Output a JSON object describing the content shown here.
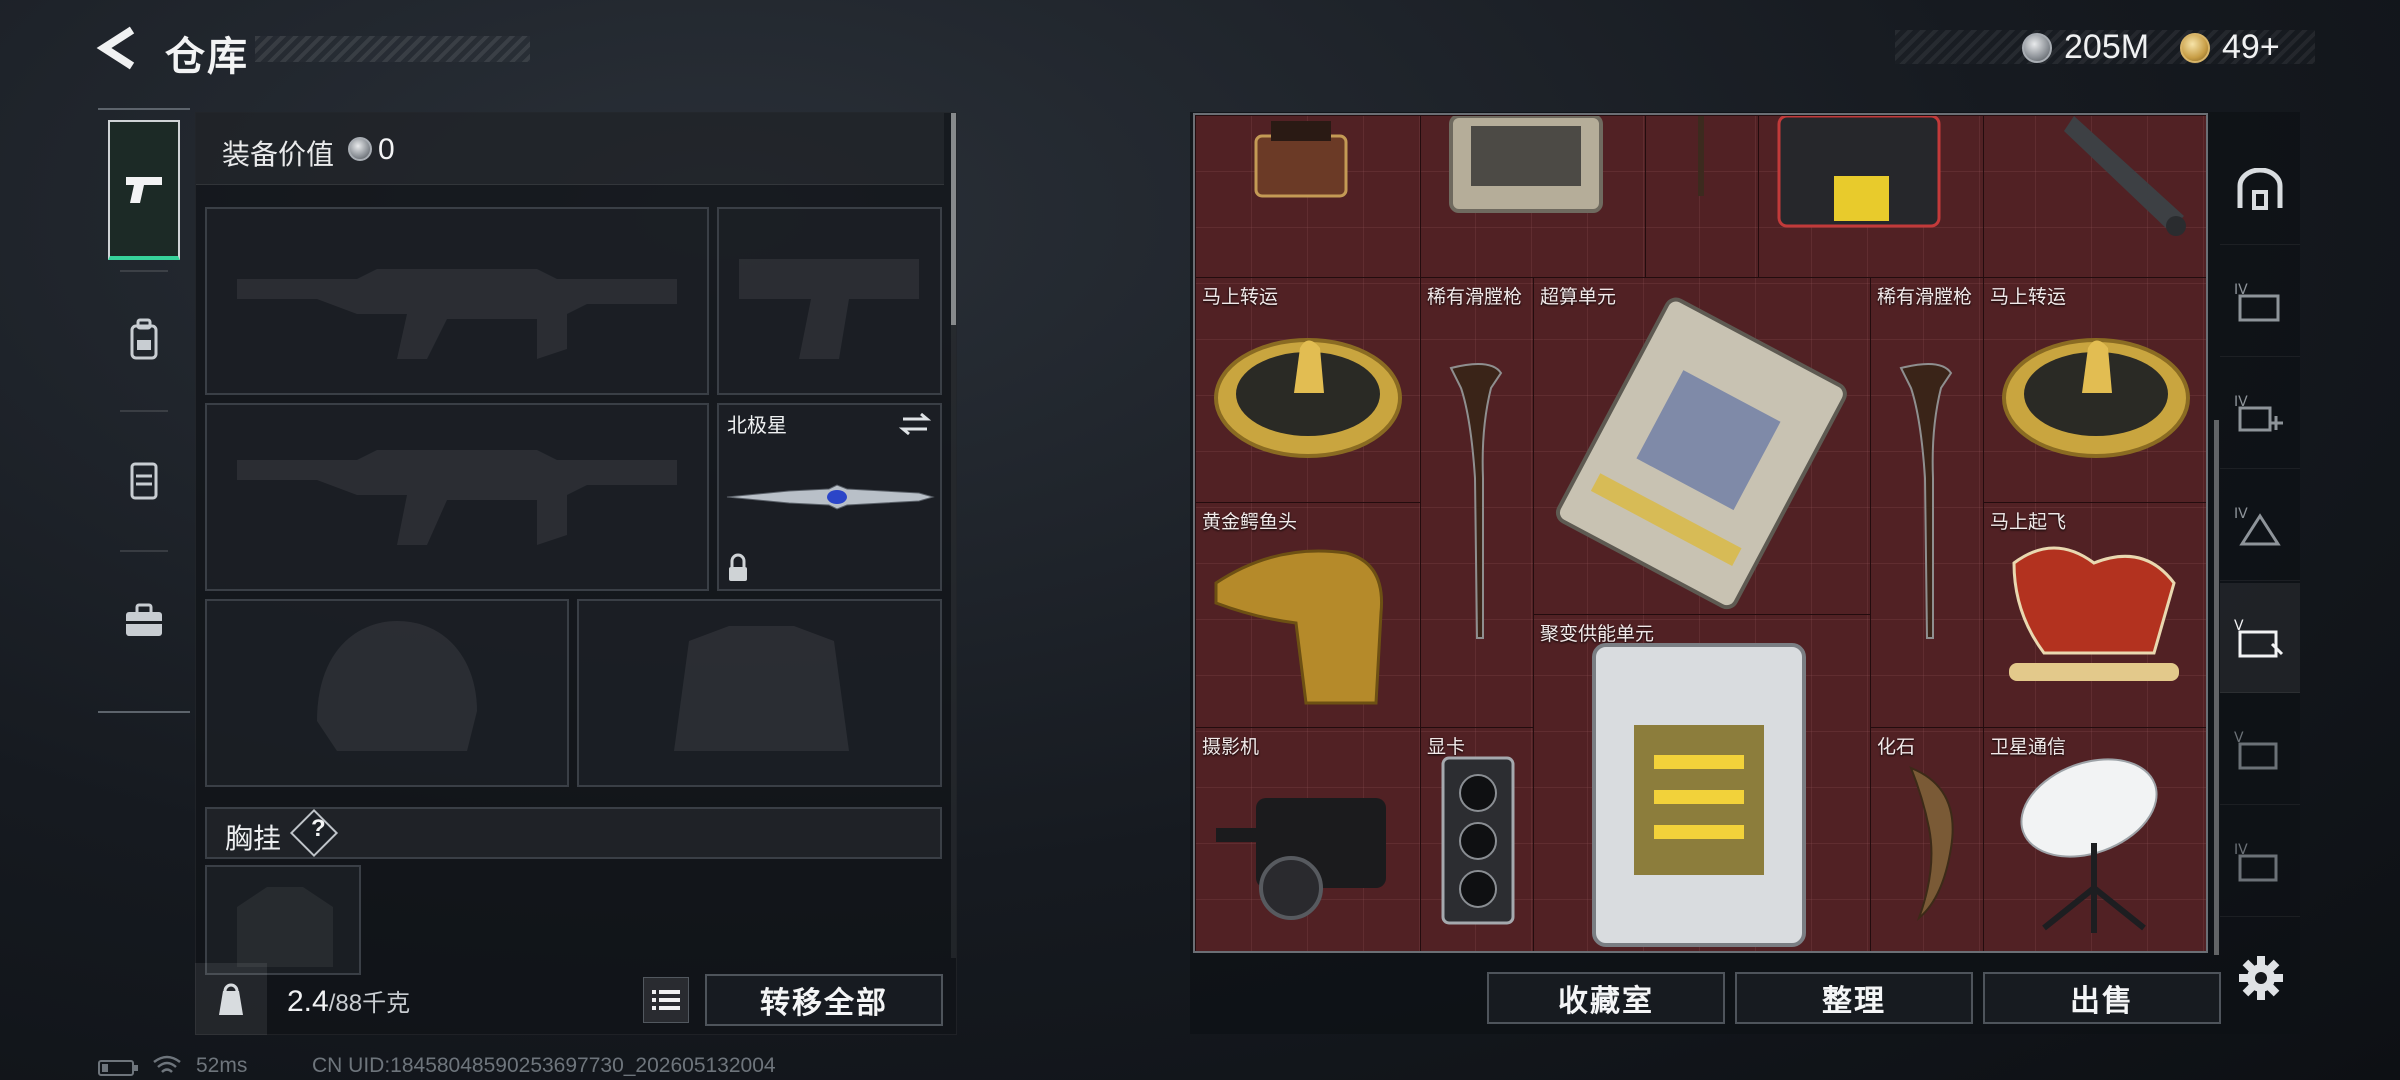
{
  "header": {
    "title": "仓库",
    "currency": [
      {
        "icon": "silver-coin-icon",
        "value": "205M"
      },
      {
        "icon": "gold-coin-icon",
        "value": "49+"
      }
    ]
  },
  "left_tabs": [
    {
      "icon": "pistol-icon",
      "active": true
    },
    {
      "icon": "backpack-icon",
      "active": false
    },
    {
      "icon": "armor-vest-icon",
      "active": false
    },
    {
      "icon": "toolbox-icon",
      "active": false
    }
  ],
  "equipment": {
    "value_label": "装备价值",
    "value": "0",
    "slots": [
      {
        "slot": "primary-weapon-1",
        "name": "",
        "empty": true
      },
      {
        "slot": "sidearm",
        "name": "",
        "empty": true
      },
      {
        "slot": "primary-weapon-2",
        "name": "",
        "empty": true
      },
      {
        "slot": "melee",
        "name": "北极星",
        "empty": false,
        "locked": true
      },
      {
        "slot": "helmet",
        "name": "",
        "empty": true
      },
      {
        "slot": "body-armor",
        "name": "",
        "empty": true
      }
    ],
    "chest_rig_label": "胸挂",
    "chest_rig_help": "?",
    "weight_current": "2.4",
    "weight_max": "/88千克",
    "transfer_all": "转移全部"
  },
  "stash": {
    "items": [
      {
        "name": "",
        "kind": "gramophone"
      },
      {
        "name": "",
        "kind": "device-case"
      },
      {
        "name": "",
        "kind": "rifle-end"
      },
      {
        "name": "",
        "kind": "radio-box"
      },
      {
        "name": "",
        "kind": "missile"
      },
      {
        "name": "马上转运",
        "kind": "gold-disc"
      },
      {
        "name": "稀有滑膛枪",
        "kind": "musket"
      },
      {
        "name": "超算单元",
        "kind": "compute-board"
      },
      {
        "name": "稀有滑膛枪",
        "kind": "musket"
      },
      {
        "name": "马上转运",
        "kind": "gold-disc"
      },
      {
        "name": "黄金鳄鱼头",
        "kind": "croc-head"
      },
      {
        "name": "马上起飞",
        "kind": "red-horse"
      },
      {
        "name": "聚变供能单元",
        "kind": "fusion-cell"
      },
      {
        "name": "摄影机",
        "kind": "camera"
      },
      {
        "name": "显卡",
        "kind": "gpu"
      },
      {
        "name": "化石",
        "kind": "fossil"
      },
      {
        "name": "卫星通信",
        "kind": "satellite-dish"
      }
    ],
    "buttons": {
      "collection": "收藏室",
      "sort": "整理",
      "sell": "出售"
    },
    "side_tabs": [
      {
        "icon": "vault-icon",
        "active": false
      },
      {
        "icon": "folder-iv-icon",
        "active": false
      },
      {
        "icon": "add-iv-icon",
        "active": false
      },
      {
        "icon": "triangle-iv-icon",
        "active": false
      },
      {
        "icon": "sell-tag-icon",
        "active": true
      },
      {
        "icon": "sell-tag-v-icon",
        "active": false
      },
      {
        "icon": "card-iv-icon",
        "active": false
      }
    ]
  },
  "status_bar": {
    "ping": "52ms",
    "uid": "CN UID:1845804859025369​7730_202605132004"
  }
}
